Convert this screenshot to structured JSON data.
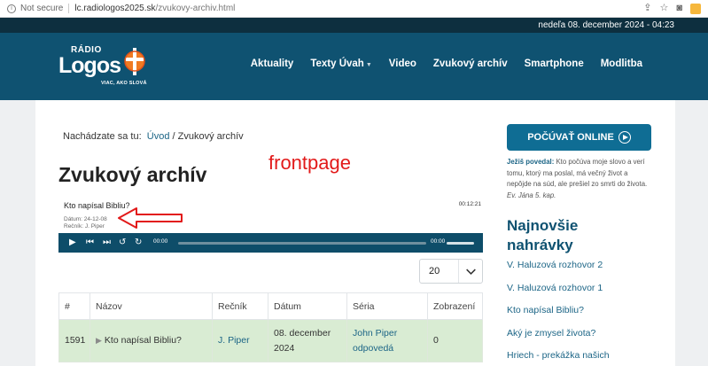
{
  "browser": {
    "security_label": "Not secure",
    "url_domain": "lc.radiologos2025.sk",
    "url_path": "/zvukovy-archiv.html"
  },
  "topbar": {
    "datetime": "nedeľa 08. december 2024 - 04:23"
  },
  "logo": {
    "radio": "RÁDIO",
    "logos": "Logos",
    "tagline": "VIAC, AKO SLOVÁ"
  },
  "nav": [
    {
      "label": "Aktuality"
    },
    {
      "label": "Texty Úvah",
      "has_dropdown": true
    },
    {
      "label": "Video"
    },
    {
      "label": "Zvukový archív"
    },
    {
      "label": "Smartphone"
    },
    {
      "label": "Modlitba"
    }
  ],
  "breadcrumb": {
    "prefix": "Nachádzate sa tu:",
    "home": "Úvod",
    "separator": "/",
    "current": "Zvukový archív"
  },
  "page_title": "Zvukový archív",
  "annotation": "frontpage",
  "player": {
    "track_title": "Kto napísal Bibliu?",
    "duration": "00:12:21",
    "date_line": "Dátum: 24-12-08",
    "speaker_line": "Rečník: J. Piper",
    "current_time": "00:00",
    "total_time": "00:00",
    "skip_back_label": "15",
    "skip_forward_label": "15"
  },
  "per_page": {
    "value": "20"
  },
  "table": {
    "headers": [
      "#",
      "Názov",
      "Rečník",
      "Dátum",
      "Séria",
      "Zobrazení"
    ],
    "rows": [
      {
        "num": "1591",
        "title": "Kto napísal Bibliu?",
        "speaker": "J. Piper",
        "date": "08. december 2024",
        "series": "John Piper odpovedá",
        "views": "0"
      }
    ]
  },
  "sidebar": {
    "listen_button": "POČÚVAŤ ONLINE",
    "quote_author": "Ježiš povedal:",
    "quote_text": " Kto počúva moje slovo a verí tomu, ktorý ma poslal, má večný život a nepôjde na súd, ale prešiel zo smrti do života.",
    "quote_ref": "Ev. Jána 5. kap.",
    "latest_heading": "Najnovšie nahrávky",
    "latest": [
      "V. Haluzová rozhovor 2",
      "V. Haluzová rozhovor 1",
      "Kto napísal Bibliu?",
      "Aký je zmysel života?",
      "Hriech - prekážka našich"
    ]
  },
  "colors": {
    "header_bg": "#0f5271",
    "topbar_bg": "#0d2f3f",
    "accent_blue": "#0f6d94",
    "row_highlight": "#d9ecd3",
    "annotation_red": "#e21a1a"
  }
}
